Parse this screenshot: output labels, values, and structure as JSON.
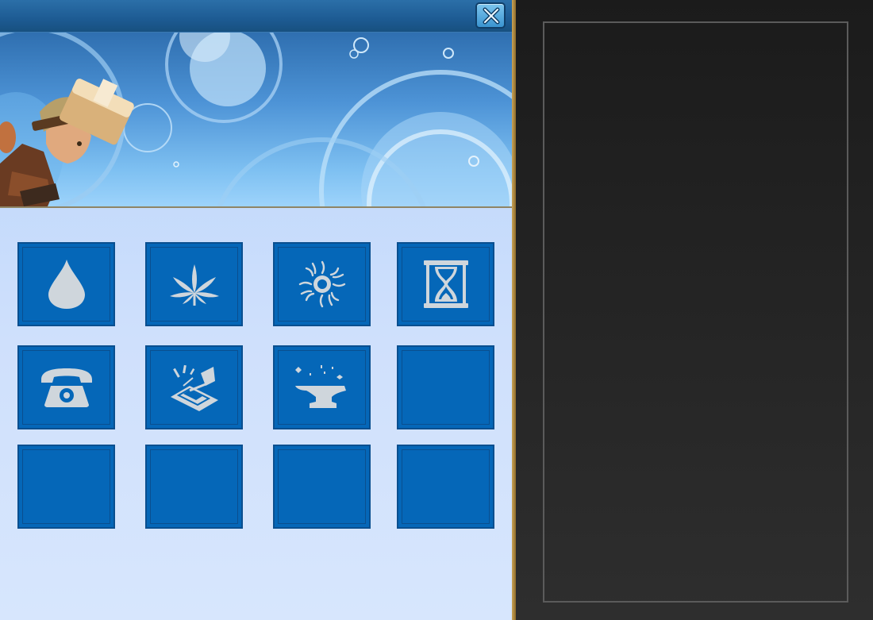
{
  "popup": {
    "close_button": {
      "icon": "close-x-icon"
    },
    "colors": {
      "tile": "#0567b8",
      "tile_border": "#0a4f8f",
      "icon": "#cfd6dc",
      "panel_bg": "#c3dafb",
      "frame_gold": "#b18a3c"
    },
    "grid": [
      {
        "slot": 1,
        "icon": "water-drop-icon",
        "filled": true
      },
      {
        "slot": 2,
        "icon": "hemp-leaf-icon",
        "filled": true
      },
      {
        "slot": 3,
        "icon": "sun-icon",
        "filled": true
      },
      {
        "slot": 4,
        "icon": "hourglass-icon",
        "filled": true
      },
      {
        "slot": 5,
        "icon": "telephone-icon",
        "filled": true
      },
      {
        "slot": 6,
        "icon": "trap-icon",
        "filled": true
      },
      {
        "slot": 7,
        "icon": "anvil-icon",
        "filled": true
      },
      {
        "slot": 8,
        "icon": "",
        "filled": false
      },
      {
        "slot": 9,
        "icon": "",
        "filled": false
      },
      {
        "slot": 10,
        "icon": "",
        "filled": false
      },
      {
        "slot": 11,
        "icon": "",
        "filled": false
      },
      {
        "slot": 12,
        "icon": "",
        "filled": false
      }
    ]
  },
  "banner": {
    "image": "bubbles-with-hammer-character"
  },
  "side_panel": {
    "content": ""
  }
}
